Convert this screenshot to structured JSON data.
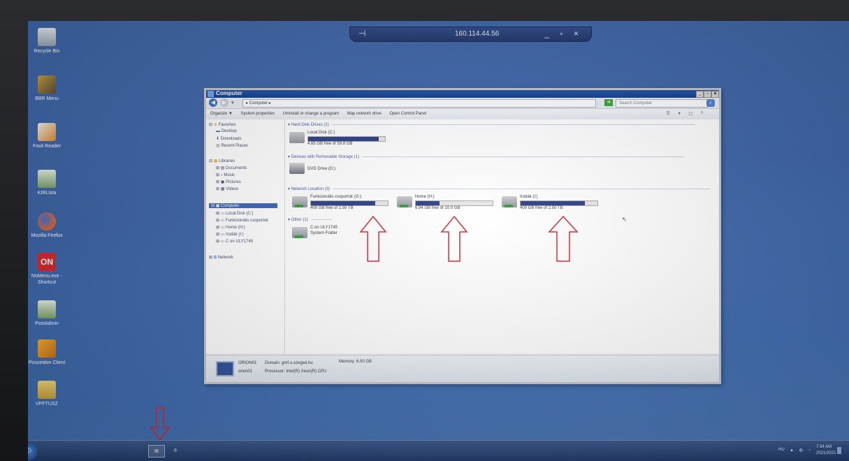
{
  "remote_bar": {
    "ip": "160.114.44.56",
    "pin_icon": "pin-icon",
    "controls": "_ ▫ ×"
  },
  "desktop_icons": [
    {
      "label": "Recycle Bin"
    },
    {
      "label": "BBR Menu"
    },
    {
      "label": "Foxit Reader"
    },
    {
      "label": "KIRLista"
    },
    {
      "label": "Mozilla Firefox"
    },
    {
      "label": "NoMenu.exe - Shortcut"
    },
    {
      "label": "PostAdmin"
    },
    {
      "label": "Poszeidon Client"
    },
    {
      "label": "VPFTUSZ"
    }
  ],
  "window": {
    "title": "Computer",
    "breadcrumb": "▸ Computer ▸",
    "search_placeholder": "Search Computer",
    "toolbar": [
      "Organize ▼",
      "System properties",
      "Uninstall or change a program",
      "Map network drive",
      "Open Control Panel"
    ],
    "nav": {
      "favorites": "Favorites",
      "fav_items": [
        "Desktop",
        "Downloads",
        "Recent Places"
      ],
      "libraries": "Libraries",
      "lib_items": [
        "Documents",
        "Music",
        "Pictures",
        "Videos"
      ],
      "computer": "Computer",
      "comp_items": [
        "Local Disk (C:)",
        "Funkcionális csoportok",
        "Home (H:)",
        "Irodák (I:)",
        "C on ULY1745"
      ],
      "network": "Network"
    },
    "groups": {
      "hdd": "Hard Disk Drives (1)",
      "removable": "Devices with Removable Storage (1)",
      "network": "Network Location (3)",
      "other": "Other (1)"
    },
    "drives": {
      "local": {
        "name": "Local Disk (C:)",
        "free": "4.65 GB free of 59.8 GB",
        "used_fraction": 0.92
      },
      "dvd": {
        "name": "DVD Drive (D:)"
      },
      "func": {
        "name": "Funkcionális csoportok (G:)",
        "free": "409 GB free of 2.50 TB",
        "used_fraction": 0.84
      },
      "home": {
        "name": "Home (H:)",
        "free": "6.94 GB free of 10.0 GB",
        "used_fraction": 0.31
      },
      "irodak": {
        "name": "Irodák (I:)",
        "free": "409 GB free of 2.50 TB",
        "used_fraction": 0.84
      },
      "culy": {
        "name": "C on ULY1745",
        "sub": "System Folder"
      }
    },
    "status": {
      "name": "ORION01",
      "domain": "Domain: gmf.u-szeged.hu",
      "memory": "Memory: 6.00 GB",
      "sub": "orion01",
      "processor": "Processor: Intel(R) Xeon(R) CPU"
    }
  },
  "taskbar": {
    "lang": "HU",
    "time": "7:34 AM",
    "date": "2021/2021"
  }
}
